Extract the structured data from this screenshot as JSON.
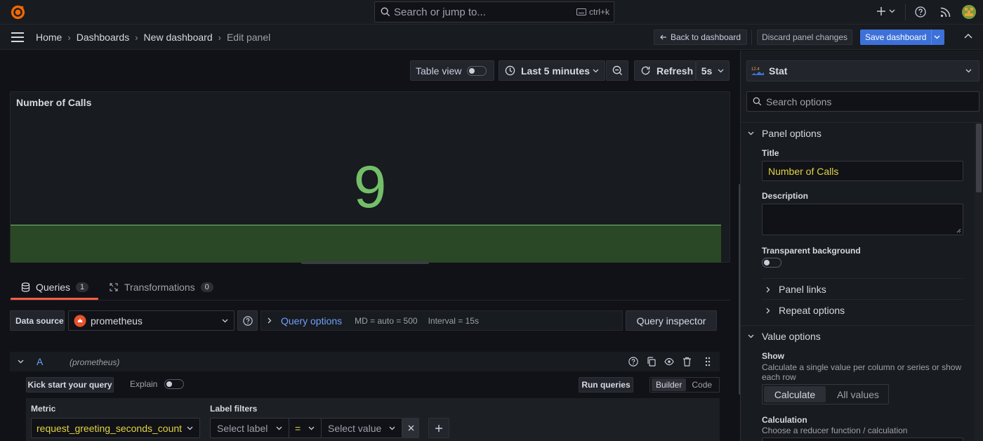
{
  "topbar": {
    "search_placeholder": "Search or jump to...",
    "search_shortcut": "ctrl+k"
  },
  "breadcrumb": [
    "Home",
    "Dashboards",
    "New dashboard",
    "Edit panel"
  ],
  "header_actions": {
    "back": "Back to dashboard",
    "discard": "Discard panel changes",
    "save": "Save dashboard"
  },
  "toolbar": {
    "table_view": "Table view",
    "time_range": "Last 5 minutes",
    "refresh": "Refresh",
    "refresh_interval": "5s"
  },
  "panel": {
    "title": "Number of Calls",
    "value": "9",
    "value_color": "#73bf69"
  },
  "query_tabs": {
    "queries_label": "Queries",
    "queries_count": "1",
    "transformations_label": "Transformations",
    "transformations_count": "0"
  },
  "datasource": {
    "label": "Data source",
    "name": "prometheus",
    "query_options": "Query options",
    "md": "MD = auto = 500",
    "interval": "Interval = 15s",
    "inspector": "Query inspector"
  },
  "query": {
    "ref": "A",
    "ds_hint": "(prometheus)",
    "kick_start": "Kick start your query",
    "explain": "Explain",
    "run": "Run queries",
    "mode_builder": "Builder",
    "mode_code": "Code",
    "metric_label": "Metric",
    "metric_value": "request_greeting_seconds_count",
    "label_filters": "Label filters",
    "select_label": "Select label",
    "operator": "=",
    "select_value": "Select value"
  },
  "options": {
    "viz": "Stat",
    "search_placeholder": "Search options",
    "panel_options": "Panel options",
    "title_label": "Title",
    "title_value": "Number of Calls",
    "description_label": "Description",
    "transparent_label": "Transparent background",
    "panel_links": "Panel links",
    "repeat_options": "Repeat options",
    "value_options": "Value options",
    "show_label": "Show",
    "show_desc": "Calculate a single value per column or series or show each row",
    "calculate": "Calculate",
    "all_values": "All values",
    "calculation_label": "Calculation",
    "calculation_desc": "Choose a reducer function / calculation"
  },
  "colors": {
    "accent_blue": "#3d71d9",
    "link_blue": "#6e9fff",
    "stat_green": "#73bf69",
    "metric_yellow": "#e0d443",
    "tab_orange": "#f55f3e"
  }
}
